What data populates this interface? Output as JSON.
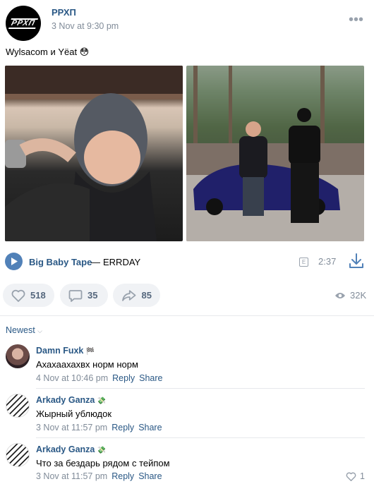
{
  "post": {
    "author": "РРХП",
    "avatar_text": "РРХП",
    "date": "3 Nov at 9:30 pm",
    "text": "Wylsacom и Yëat 😳",
    "more_icon": "more-horizontal-icon"
  },
  "audio": {
    "artist": "Big Baby Tape",
    "separator": "—",
    "title": "ERRDAY",
    "explicit": "E",
    "duration": "2:37",
    "accent_color": "#5181b8"
  },
  "actions": {
    "likes": "518",
    "comments": "35",
    "shares": "85",
    "views": "32K"
  },
  "comments_section": {
    "sort_label": "Newest",
    "items": [
      {
        "name": "Damn Fuxk",
        "badge": "🏁",
        "text": "Ахахаахахвх норм норм",
        "date": "4 Nov at 10:46 pm",
        "reply": "Reply",
        "share": "Share"
      },
      {
        "name": "Arkady Ganza",
        "badge": "💸",
        "text": "Жырный ублюдок",
        "date": "3 Nov at 11:57 pm",
        "reply": "Reply",
        "share": "Share"
      },
      {
        "name": "Arkady Ganza",
        "badge": "💸",
        "text": "Что за бездарь рядом с тейпом",
        "date": "3 Nov at 11:57 pm",
        "reply": "Reply",
        "share": "Share",
        "likes": "1"
      }
    ]
  },
  "colors": {
    "link": "#2a5885",
    "muted": "#818c99",
    "button_bg": "#f0f2f5"
  }
}
